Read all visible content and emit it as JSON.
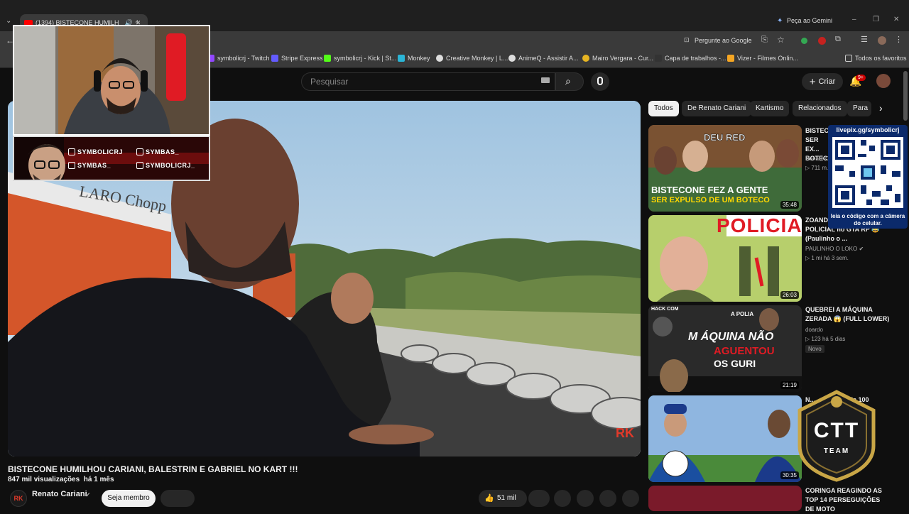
{
  "browser": {
    "tab_title": "(1394) BISTECONE HUMILH",
    "gemini_label": "Peça ao Gemini",
    "google_label": "Pergunte ao Google",
    "bookmarks": [
      "symbolicrj - Twitch",
      "Stripe Express",
      "symbolicrj - Kick | St...",
      "Monkey",
      "Creative Monkey | L...",
      "AnimeQ - Assistir A...",
      "Mairo Vergara - Cur...",
      "Capa de trabalhos -...",
      "Vizer - Filmes Onlin..."
    ],
    "all_bookmarks": "Todos os favoritos"
  },
  "header": {
    "search_placeholder": "Pesquisar",
    "create_label": "Criar",
    "notif_count": "9+"
  },
  "overlay": {
    "socials": [
      "SYMBOLICRJ",
      "SYMBAS_",
      "SYMBAS_",
      "SYMBOLICRJ_"
    ],
    "qr_title": "livepix.gg/symbolicrj",
    "qr_caption": "leia o código com a câmera do celular.",
    "ctt_title": "CTT",
    "ctt_sub": "TEAM"
  },
  "video": {
    "title": "BISTECONE HUMILHOU CARIANI, BALESTRIN E GABRIEL NO KART !!!",
    "views": "847 mil visualizações",
    "age": "há 1 mês",
    "channel": "Renato Cariani",
    "join_label": "Seja membro",
    "likes": "51 mil",
    "scene_text": "LARO Chopp"
  },
  "chips": [
    "Todos",
    "De Renato Cariani",
    "Kartismo",
    "Relacionados",
    "Para"
  ],
  "recommendations": [
    {
      "title": "BISTEC... SER EX... BOTEC...",
      "channel": "Renato C...",
      "meta": "711 m...",
      "duration": "35:48",
      "thumb_text": [
        "DEU RED",
        "BISTECONE FEZ A GENTE",
        "SER EXPULSO DE UM BOTECO"
      ]
    },
    {
      "title": "ZOAND... RECRUTAMENTO POLICIAL no GTA RP 😂 (Paulinho o ...",
      "channel": "PAULINHO O LOKO",
      "meta": "1 mi  há 3 sem.",
      "duration": "26:03",
      "thumb_text": [
        "POLICIA"
      ]
    },
    {
      "title": "QUEBREI A MÁQUINA ZERADA 😱 (FULL LOWER)",
      "channel": "doardo",
      "meta": "123  há 5 dias",
      "badge": "Novo",
      "duration": "21:19",
      "thumb_text": [
        "HACK COM",
        "A POLIA",
        "M ÁQUINA NÃO",
        "AGUENTOU",
        "OS GURI"
      ]
    },
    {
      "title": "N... ...ick vs ... de 100",
      "duration": "30:35"
    },
    {
      "title": "CORINGA REAGINDO AS TOP 14 PERSEGUIÇÕES DE MOTO"
    }
  ],
  "colors": {
    "accent": "#ff0000",
    "bg": "#0f0f0f",
    "chip": "#272727"
  }
}
